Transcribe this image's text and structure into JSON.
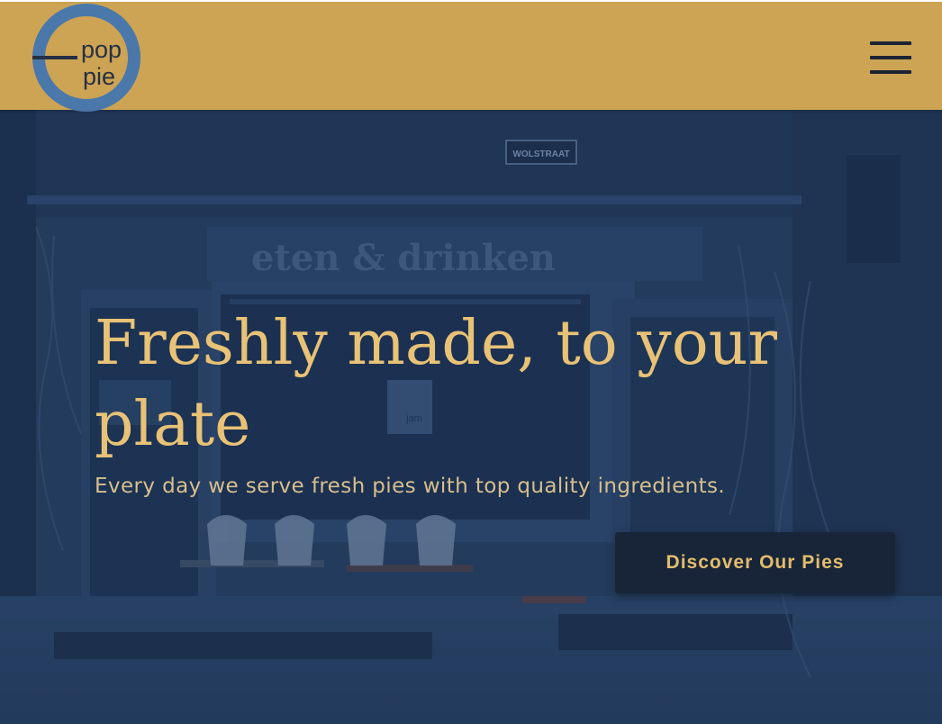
{
  "header": {
    "logo": {
      "line1": "pop",
      "line2": "pie"
    },
    "menu_icon": "hamburger-menu-icon"
  },
  "hero": {
    "background_image": {
      "signs": [
        "WOLSTRAAT",
        "eten & drinken",
        "jam"
      ]
    },
    "title": "Freshly made, to your plate",
    "subtitle": "Every day we serve fresh pies with top quality ingredients.",
    "cta_label": "Discover Our Pies"
  },
  "colors": {
    "header_bg": "#cda454",
    "logo_ring": "#4a78ab",
    "hero_title": "#e8c276",
    "cta_bg": "#182539",
    "cta_text": "#e3bd6c"
  }
}
